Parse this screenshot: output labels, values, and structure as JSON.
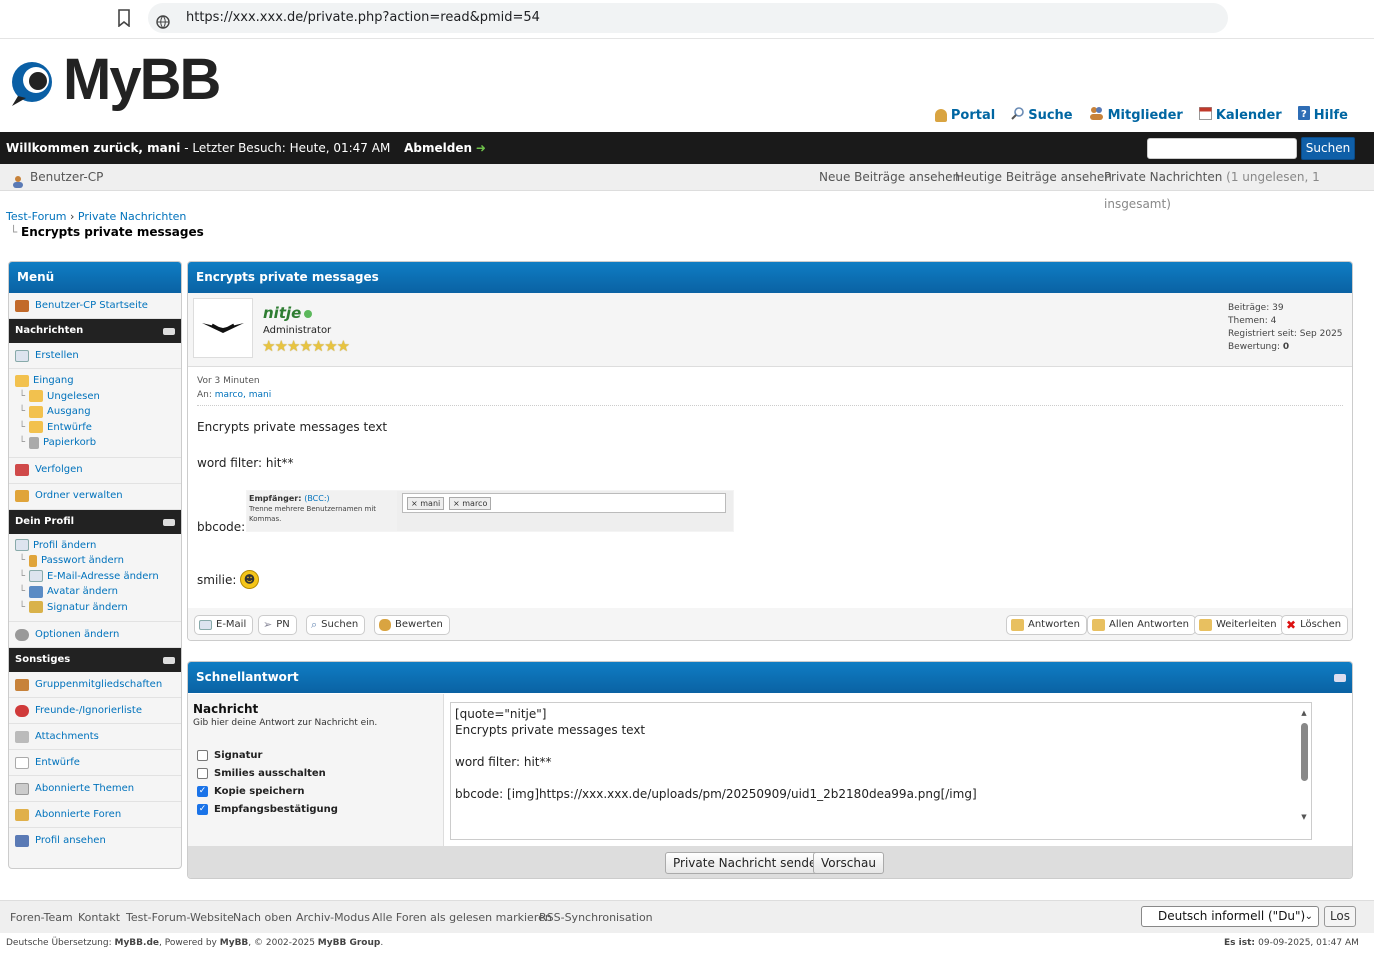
{
  "browser": {
    "url": "https://xxx.xxx.de/private.php?action=read&pmid=54"
  },
  "header": {
    "logo_text": "MyBB",
    "links": [
      {
        "label": "Portal",
        "icon": "portal-icon",
        "color": "#d9a441"
      },
      {
        "label": "Suche",
        "icon": "search-icon",
        "color": "#6a8bb5"
      },
      {
        "label": "Mitglieder",
        "icon": "members-icon",
        "color": "#c7823a"
      },
      {
        "label": "Kalender",
        "icon": "calendar-icon",
        "color": "#c0392b"
      },
      {
        "label": "Hilfe",
        "icon": "help-icon",
        "color": "#2e6db5"
      }
    ]
  },
  "welcome": {
    "greeting": "Willkommen zurück, mani",
    "last_visit": " - Letzter Besuch: Heute, 01:47 AM",
    "logout": "Abmelden",
    "search_button": "Suchen"
  },
  "subbar": {
    "ucp": "Benutzer-CP",
    "new_posts": "Neue Beiträge ansehen",
    "todays_posts": "Heutige Beiträge ansehen",
    "pm_label": "Private Nachrichten",
    "pm_count": " (1 ungelesen, 1 insgesamt)"
  },
  "breadcrumb": {
    "forum": "Test-Forum",
    "sep": " › ",
    "pms": "Private Nachrichten",
    "current": "Encrypts private messages"
  },
  "sidebar": {
    "title": "Menü",
    "home": "Benutzer-CP Startseite",
    "sections": [
      {
        "title": "Nachrichten"
      },
      {
        "title": "Dein Profil"
      },
      {
        "title": "Sonstiges"
      }
    ],
    "compose": "Erstellen",
    "inbox": "Eingang",
    "unread": "Ungelesen",
    "sent": "Ausgang",
    "drafts": "Entwürfe",
    "trash": "Papierkorb",
    "tracking": "Verfolgen",
    "folders": "Ordner verwalten",
    "profile_edit": "Profil ändern",
    "password": "Passwort ändern",
    "email": "E-Mail-Adresse ändern",
    "avatar": "Avatar ändern",
    "signature": "Signatur ändern",
    "options": "Optionen ändern",
    "groups": "Gruppenmitgliedschaften",
    "buddies": "Freunde-/Ignorierliste",
    "attachments": "Attachments",
    "drafts2": "Entwürfe",
    "sub_threads": "Abonnierte Themen",
    "sub_forums": "Abonnierte Foren",
    "view_profile": "Profil ansehen"
  },
  "post": {
    "title": "Encrypts private messages",
    "author": "nitje",
    "role": "Administrator",
    "stars": 7,
    "stats": {
      "posts": "Beiträge: 39",
      "threads": "Themen: 4",
      "registered": "Registriert seit: Sep 2025",
      "rating_label": "Bewertung: ",
      "rating": "0"
    },
    "time": "Vor 3 Minuten",
    "to_label": "An: ",
    "to": "marco, mani",
    "body": {
      "line1": "Encrypts private messages text",
      "line2": "word filter: hit**",
      "bbcode_label": "bbcode:",
      "smilie_label": "smilie:"
    },
    "embed": {
      "recipient_label": "Empfänger:",
      "bcc": "(BCC:)",
      "hint": "Trenne mehrere Benutzernamen mit Kommas.",
      "tag1": "mani",
      "tag2": "marco"
    },
    "buttons": {
      "email": "E-Mail",
      "pm": "PN",
      "find": "Suchen",
      "rate": "Bewerten",
      "reply": "Antworten",
      "reply_all": "Allen Antworten",
      "forward": "Weiterleiten",
      "delete": "Löschen"
    }
  },
  "quickreply": {
    "title": "Schnellantwort",
    "label": "Nachricht",
    "hint": "Gib hier deine Antwort zur Nachricht ein.",
    "options": [
      {
        "label": "Signatur",
        "checked": false
      },
      {
        "label": "Smilies ausschalten",
        "checked": false
      },
      {
        "label": "Kopie speichern",
        "checked": true
      },
      {
        "label": "Empfangsbestätigung",
        "checked": true
      }
    ],
    "text": {
      "l1": "[quote=\"nitje\"]",
      "l2": "Encrypts private messages text",
      "l3": "word filter: hit**",
      "l4": "bbcode: [img]https://xxx.xxx.de/uploads/pm/20250909/uid1_2b2180dea99a.png[/img]"
    },
    "send": "Private Nachricht senden",
    "preview": "Vorschau"
  },
  "footer": {
    "links": [
      "Foren-Team",
      "Kontakt",
      "Test-Forum-Website",
      "Nach oben",
      "Archiv-Modus",
      "Alle Foren als gelesen markieren",
      "RSS-Synchronisation"
    ],
    "language": "Deutsch informell (\"Du\")",
    "go": "Los",
    "copyright_prefix": "Deutsche Übersetzung: ",
    "mybb_de": "MyBB.de",
    "powered": ", Powered by ",
    "mybb": "MyBB",
    "years": ", © 2002-2025 ",
    "group": "MyBB Group",
    "dot": ".",
    "time_label": "Es ist: ",
    "time": "09-09-2025, 01:47 AM"
  }
}
